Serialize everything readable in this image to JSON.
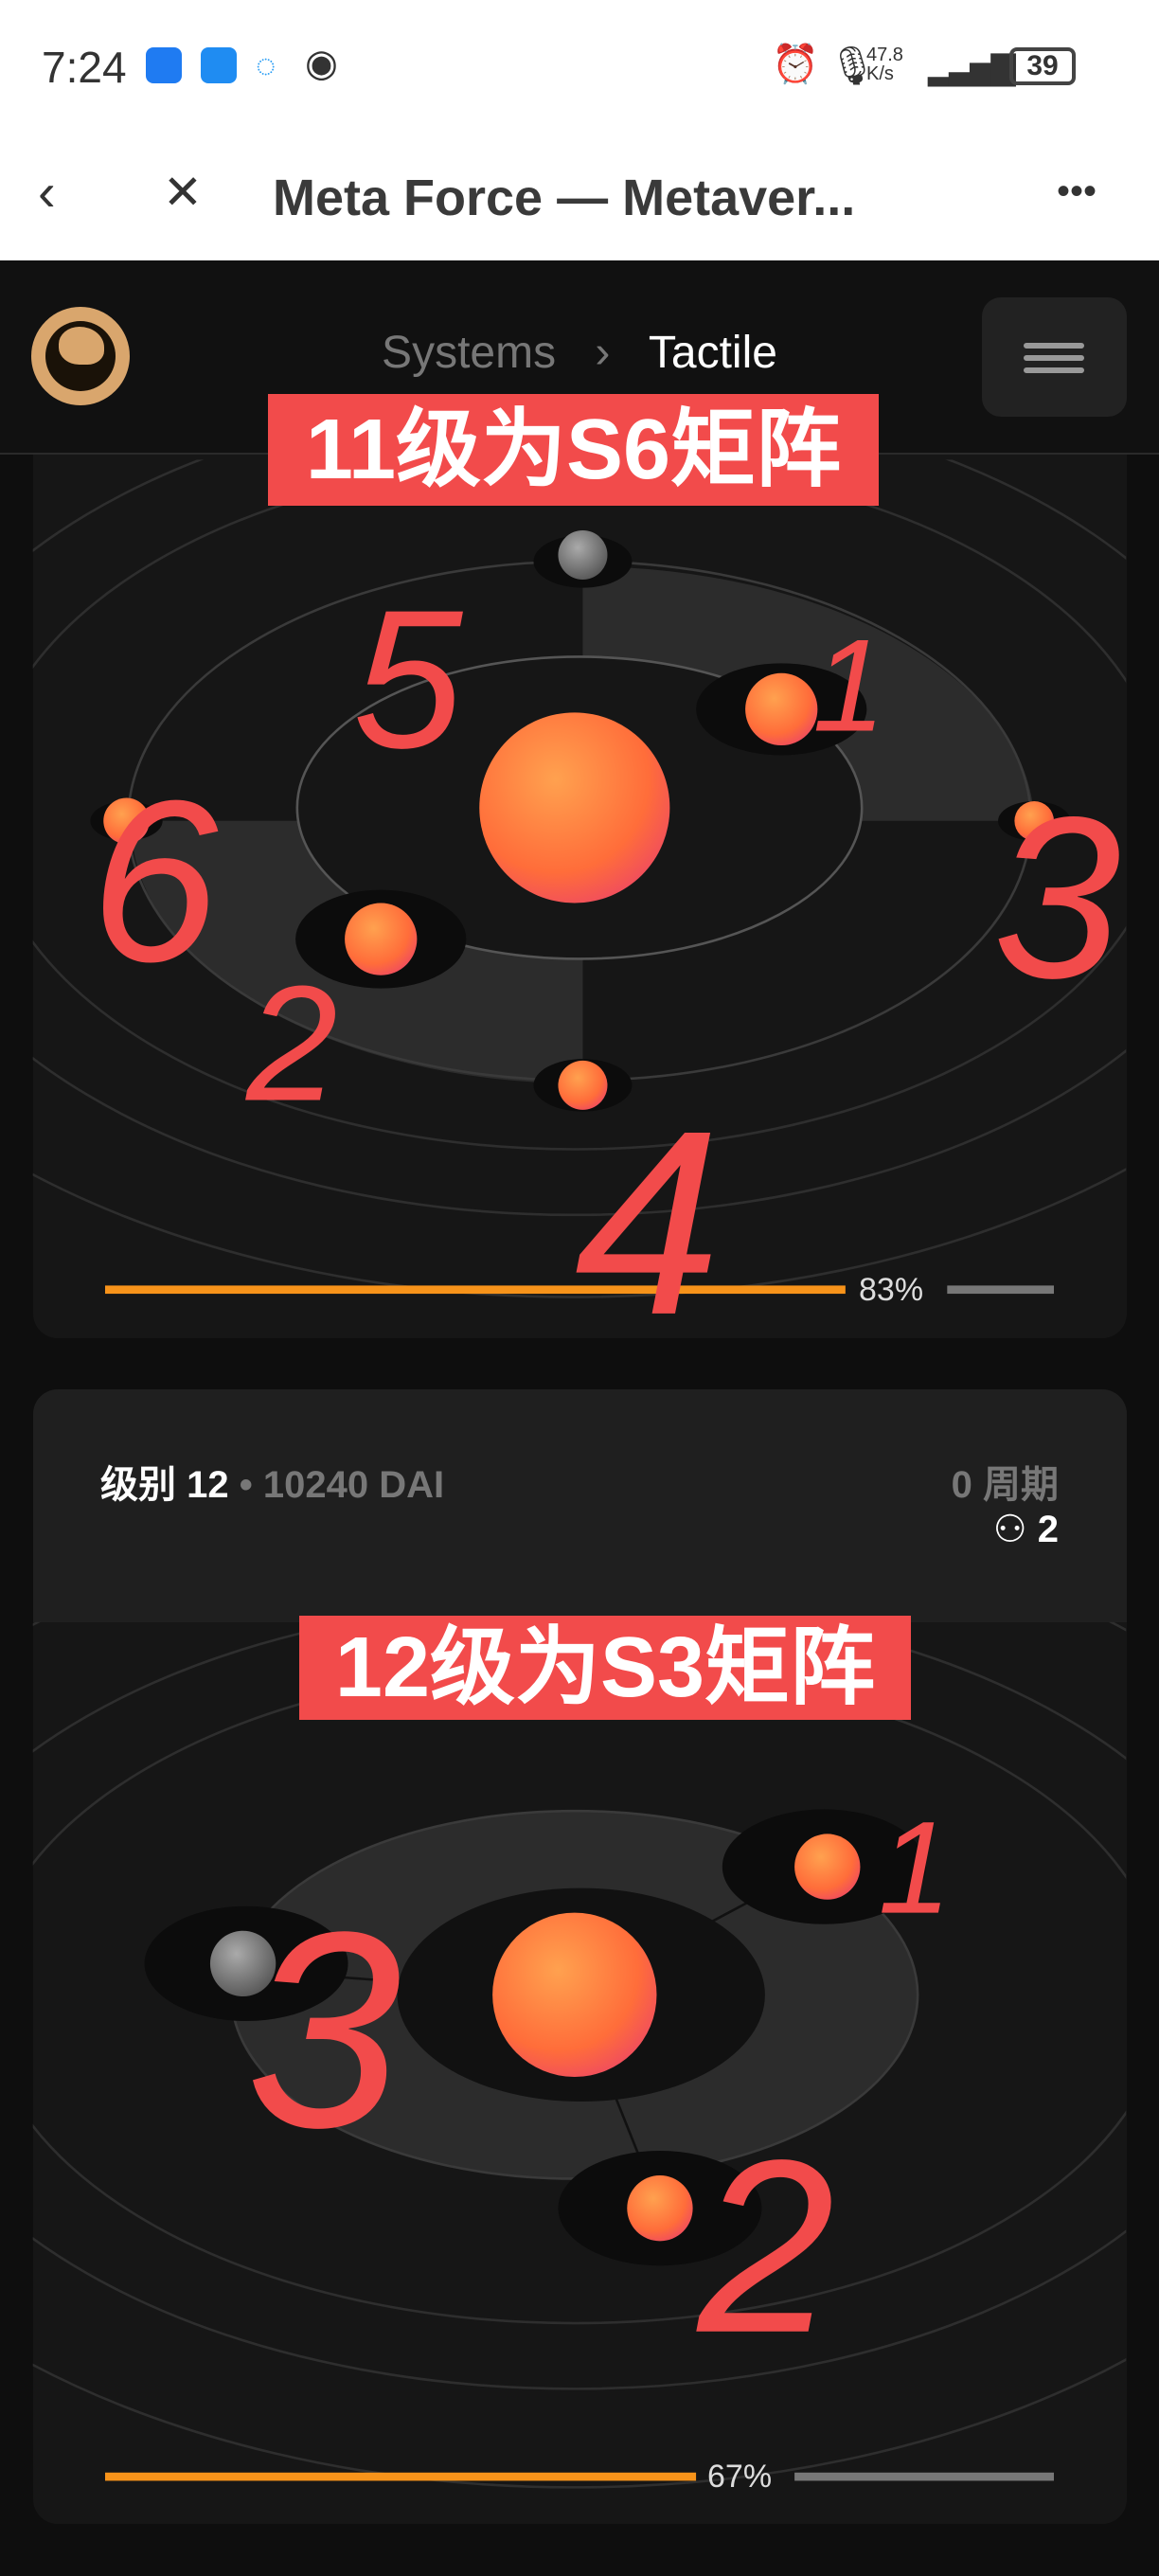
{
  "status_bar": {
    "time": "7:24",
    "net_speed": "47.8 K/s",
    "battery": "39"
  },
  "browser": {
    "title": "Meta Force — Metaver..."
  },
  "header": {
    "breadcrumb": [
      "Systems",
      "Tactile"
    ]
  },
  "annotations": {
    "card1_label": "11级为S6矩阵",
    "card2_label": "12级为S3矩阵",
    "card1_numbers": [
      "5",
      "1",
      "6",
      "3",
      "2",
      "4"
    ],
    "card2_numbers": [
      "1",
      "3",
      "2"
    ],
    "color": "#f24b4b"
  },
  "cards": [
    {
      "progress": 83,
      "progress_label": "83%"
    },
    {
      "level_label": "级别 12",
      "price": "10240 DAI",
      "cycles": "0 周期",
      "members": "2",
      "progress": 67,
      "progress_label": "67%"
    }
  ],
  "colors": {
    "accent": "#f7931a",
    "sphere": "#ff7a3c"
  }
}
